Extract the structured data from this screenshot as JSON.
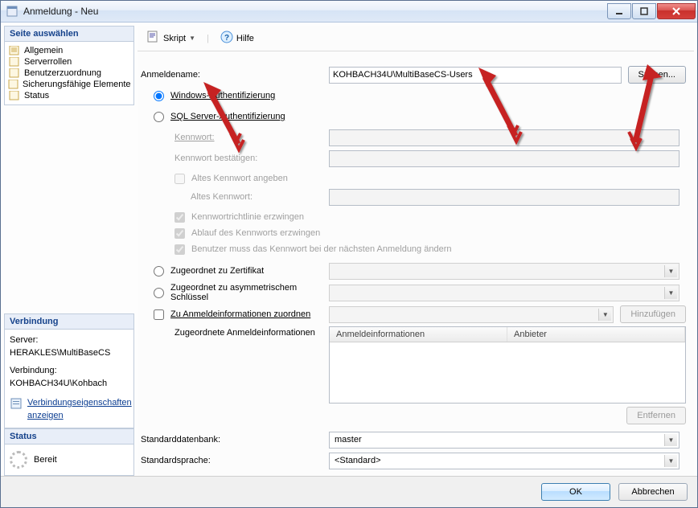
{
  "window": {
    "title": "Anmeldung - Neu"
  },
  "sidebar": {
    "header": "Seite auswählen",
    "items": [
      {
        "label": "Allgemein"
      },
      {
        "label": "Serverrollen"
      },
      {
        "label": "Benutzerzuordnung"
      },
      {
        "label": "Sicherungsfähige Elemente"
      },
      {
        "label": "Status"
      }
    ]
  },
  "connection": {
    "header": "Verbindung",
    "server_label": "Server:",
    "server_value": "HERAKLES\\MultiBaseCS",
    "conn_label": "Verbindung:",
    "conn_value": "KOHBACH34U\\Kohbach",
    "link": "Verbindungseigenschaften anzeigen"
  },
  "status": {
    "header": "Status",
    "text": "Bereit"
  },
  "toolbar": {
    "script": "Skript",
    "help": "Hilfe"
  },
  "form": {
    "login_name_label": "Anmeldename:",
    "login_name_value": "KOHBACH34U\\MultiBaseCS-Users",
    "search_btn": "Suchen...",
    "auth_windows": "Windows-Authentifizierung",
    "auth_sql": "SQL Server-Authentifizierung",
    "password_label": "Kennwort:",
    "password_confirm_label": "Kennwort bestätigen:",
    "old_pw_chk": "Altes Kennwort angeben",
    "old_pw_label": "Altes Kennwort:",
    "policy_chk": "Kennwortrichtlinie erzwingen",
    "expire_chk": "Ablauf des Kennworts erzwingen",
    "mustchange_chk": "Benutzer muss das Kennwort bei der nächsten Anmeldung ändern",
    "mapped_cert": "Zugeordnet zu Zertifikat",
    "mapped_asym": "Zugeordnet zu asymmetrischem Schlüssel",
    "map_creds_chk": "Zu Anmeldeinformationen zuordnen",
    "add_btn": "Hinzufügen",
    "mapped_creds_label": "Zugeordnete Anmeldeinformationen",
    "col_cred": "Anmeldeinformationen",
    "col_provider": "Anbieter",
    "remove_btn": "Entfernen",
    "default_db_label": "Standarddatenbank:",
    "default_db_value": "master",
    "default_lang_label": "Standardsprache:",
    "default_lang_value": "<Standard>"
  },
  "footer": {
    "ok": "OK",
    "cancel": "Abbrechen"
  }
}
